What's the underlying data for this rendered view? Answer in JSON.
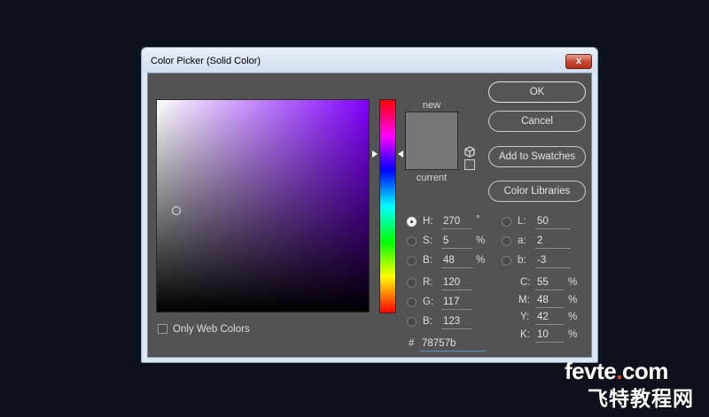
{
  "window": {
    "title": "Color Picker (Solid Color)",
    "close_label": "x"
  },
  "buttons": {
    "ok": "OK",
    "cancel": "Cancel",
    "add_to_swatches": "Add to Swatches",
    "color_libraries": "Color Libraries"
  },
  "swatch": {
    "new_label": "new",
    "current_label": "current",
    "new_color": "#78757b",
    "current_color": "#78757b"
  },
  "hsb": [
    {
      "label": "H:",
      "value": "270",
      "unit": "°",
      "selected": true
    },
    {
      "label": "S:",
      "value": "5",
      "unit": "%",
      "selected": false
    },
    {
      "label": "B:",
      "value": "48",
      "unit": "%",
      "selected": false
    }
  ],
  "rgb": [
    {
      "label": "R:",
      "value": "120"
    },
    {
      "label": "G:",
      "value": "117"
    },
    {
      "label": "B:",
      "value": "123"
    }
  ],
  "lab": [
    {
      "label": "L:",
      "value": "50"
    },
    {
      "label": "a:",
      "value": "2"
    },
    {
      "label": "b:",
      "value": "-3"
    }
  ],
  "cmyk": [
    {
      "label": "C:",
      "value": "55",
      "unit": "%"
    },
    {
      "label": "M:",
      "value": "48",
      "unit": "%"
    },
    {
      "label": "Y:",
      "value": "42",
      "unit": "%"
    },
    {
      "label": "K:",
      "value": "10",
      "unit": "%"
    }
  ],
  "hex": {
    "label": "#",
    "value": "78757b"
  },
  "only_web_colors": {
    "label": "Only Web Colors",
    "checked": false
  },
  "hue_field_color": "#8000ff",
  "watermark": {
    "line1_a": "fevte",
    "line1_b": ".",
    "line1_c": "com",
    "line2": "飞特教程网"
  }
}
